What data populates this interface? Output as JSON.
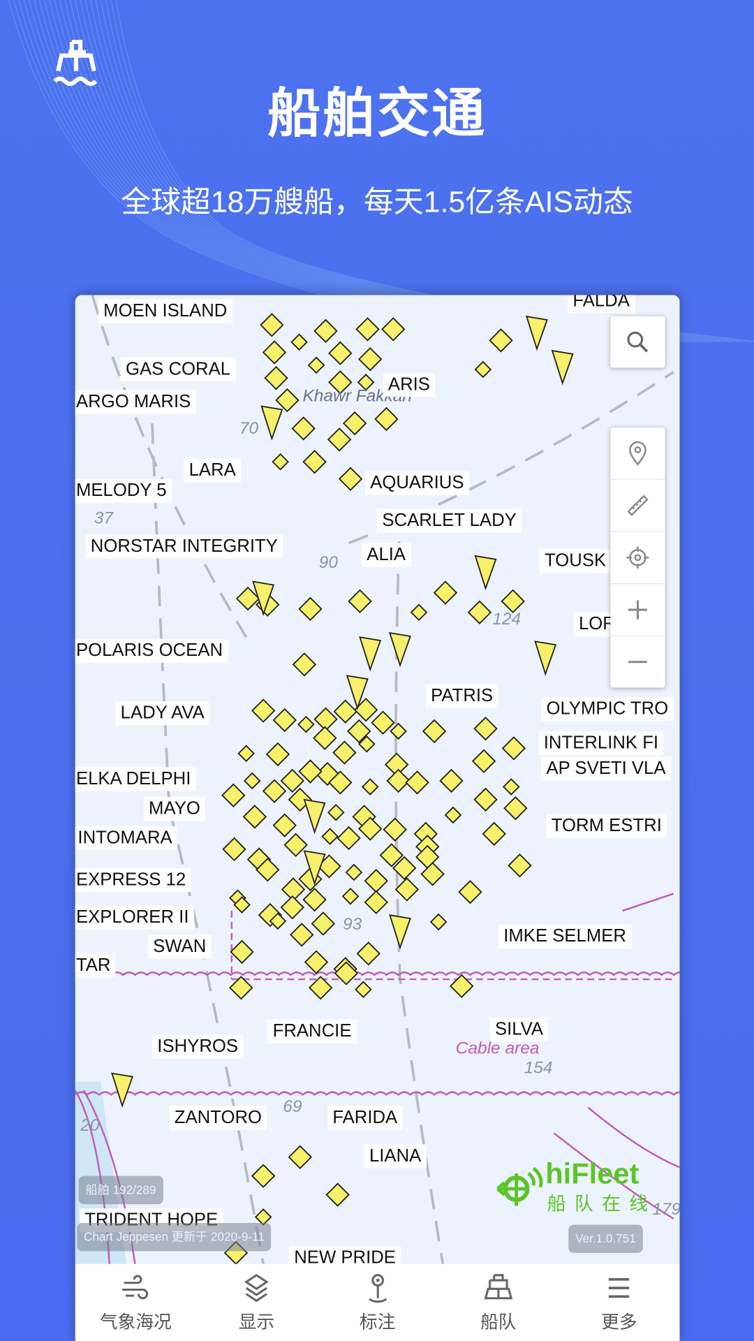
{
  "header": {
    "title": "船舶交通",
    "subtitle": "全球超18万艘船，每天1.5亿条AIS动态",
    "icon": "ship-icon"
  },
  "map": {
    "ship_labels": [
      "MOEN ISLAND",
      "GAS CORAL",
      "ARGO MARIS",
      "ARIS",
      "FALDA",
      "LARA",
      "AQUARIUS",
      "MELODY 5",
      "SCARLET LADY",
      "NORSTAR INTEGRITY",
      "ALIA",
      "TOUSK",
      "LORD",
      "POLARIS OCEAN",
      "PATRIS",
      "LADY AVA",
      "OLYMPIC TRO",
      "INTERLINK FI",
      "AP SVETI VLA",
      "ELKA DELPHI",
      "MAYO",
      "INTOMARA",
      "TORM ESTRI",
      "EXPRESS 12",
      "EXPLORER II",
      "SWAN",
      "IMKE SELMER",
      "TAR",
      "FRANCIE",
      "SILVA",
      "ISHYROS",
      "ZANTORO",
      "FARIDA",
      "LIANA",
      "TRIDENT HOPE",
      "NEW PRIDE"
    ],
    "chart_text": [
      "70",
      "37",
      "90",
      "124",
      "93",
      "154",
      "20",
      "69",
      "179",
      "Cable area",
      "Khawr Fakkan"
    ],
    "ship_count": "船舶 192/289",
    "chart_source": "Chart Jeppesen 更新于 2020-9-11",
    "version": "Ver.1.0.751",
    "brand": {
      "name": "hiFleet",
      "tagline": "船队在线",
      "color": "#5cc42a"
    },
    "ship_color": "#f7f06a",
    "controls": [
      "search-icon",
      "location-pin-icon",
      "ruler-icon",
      "crosshair-icon",
      "zoom-in-icon",
      "zoom-out-icon"
    ]
  },
  "nav": [
    {
      "label": "气象海况",
      "icon": "wind-icon"
    },
    {
      "label": "显示",
      "icon": "layers-icon"
    },
    {
      "label": "标注",
      "icon": "pin-icon"
    },
    {
      "label": "船队",
      "icon": "ship-icon"
    },
    {
      "label": "更多",
      "icon": "menu-icon"
    }
  ]
}
